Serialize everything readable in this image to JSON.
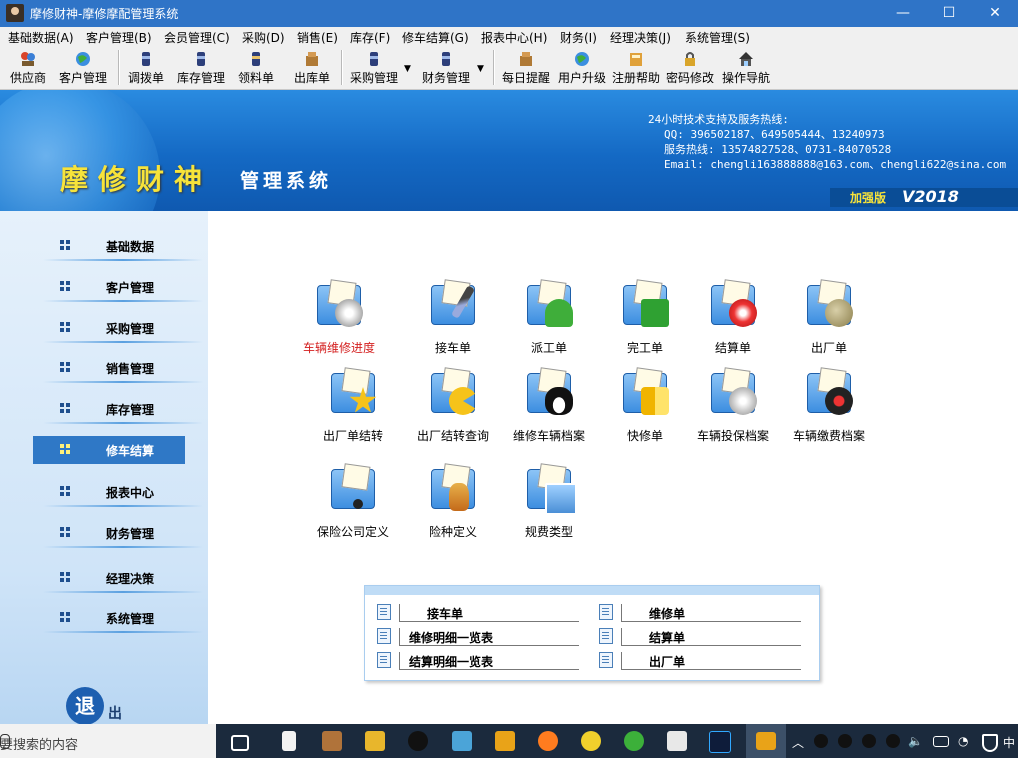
{
  "window": {
    "title": "摩修财神-摩修摩配管理系统",
    "minimize": "—",
    "maximize": "☐",
    "close": "✕"
  },
  "menu": [
    "基础数据(A)",
    "客户管理(B)",
    "会员管理(C)",
    "采购(D)",
    "销售(E)",
    "库存(F)",
    "修车结算(G)",
    "报表中心(H)",
    "财务(I)",
    "经理决策(J)",
    "系统管理(S)"
  ],
  "toolbar": [
    "供应商",
    "客户管理",
    "调拨单",
    "库存管理",
    "领料单",
    "出库单",
    "采购管理",
    "财务管理",
    "每日提醒",
    "用户升级",
    "注册帮助",
    "密码修改",
    "操作导航"
  ],
  "banner": {
    "title_main": "摩修财神",
    "title_sub": "管理系统",
    "support_title": "24小时技术支持及服务热线:",
    "qq": "QQ: 396502187、649505444、13240973",
    "hotline": "服务热线: 13574827528、0731-84070528",
    "email": "Email: chengli163888888@163.com、chengli622@sina.com",
    "edition": "加强版",
    "version": "V2018"
  },
  "sidebar": {
    "items": [
      "基础数据",
      "客户管理",
      "采购管理",
      "销售管理",
      "库存管理",
      "修车结算",
      "报表中心",
      "财务管理",
      "经理决策",
      "系统管理"
    ],
    "active": "修车结算",
    "exit_1": "退",
    "exit_2": "出"
  },
  "tiles": [
    "车辆维修进度",
    "接车单",
    "派工单",
    "完工单",
    "结算单",
    "出厂单",
    "出厂单结转",
    "出厂结转查询",
    "维修车辆档案",
    "快修单",
    "车辆投保档案",
    "车辆缴费档案",
    "保险公司定义",
    "险种定义",
    "规费类型"
  ],
  "highlight_color": "#d42020",
  "quick_links": [
    "接车单",
    "维修单",
    "维修明细一览表",
    "结算单",
    "结算明细一览表",
    "出厂单"
  ],
  "taskbar": {
    "search_placeholder": "要搜索的内容",
    "ime": "中"
  }
}
